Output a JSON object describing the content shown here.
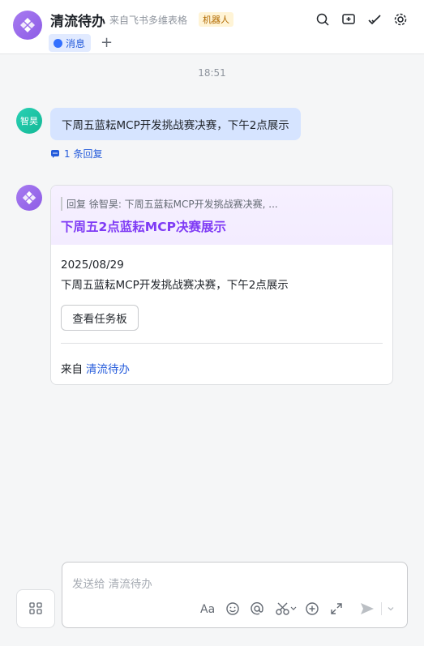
{
  "header": {
    "title": "清流待办",
    "subtitle": "来自飞书多维表格",
    "bot_tag": "机器人",
    "tab_message": "消息",
    "tab_add": "+",
    "icons": [
      "search-icon",
      "add-chat-icon",
      "check-icon",
      "settings-icon"
    ]
  },
  "chat": {
    "time": "18:51",
    "user_avatar_text": "智昊",
    "user_message": "下周五蓝耘MCP开发挑战赛决赛，下午2点展示",
    "reply_count": "1 条回复",
    "card": {
      "quote": "回复 徐智昊: 下周五蓝耘MCP开发挑战赛决赛, ...",
      "title": "下周五2点蓝耘MCP决赛展示",
      "date": "2025/08/29",
      "description": "下周五蓝耘MCP开发挑战赛决赛，下午2点展示",
      "button_label": "查看任务板",
      "from_label": "来自",
      "from_link": "清流待办"
    }
  },
  "composer": {
    "placeholder": "发送给 清流待办",
    "toolbar_icons": [
      "text-format-icon",
      "emoji-icon",
      "mention-icon",
      "scissors-icon",
      "plus-circle-icon",
      "expand-icon",
      "send-icon",
      "chevron-down-icon"
    ]
  },
  "colors": {
    "accent": "#3370ff",
    "card_title": "#7f3bf5",
    "bubble": "#d6e4ff"
  }
}
